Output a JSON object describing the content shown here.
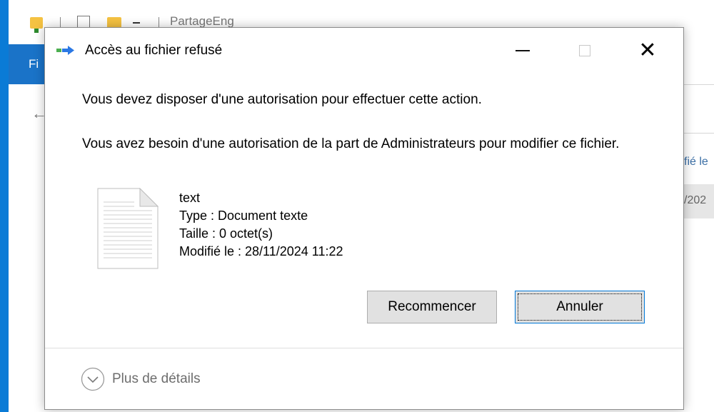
{
  "background_window": {
    "title": "PartageEng",
    "ribbon_tab": "Fi",
    "back_arrow": "←",
    "column_label": "fié le",
    "cell_value": "/202",
    "accent_color": "#0a7bd6"
  },
  "dialog": {
    "title": "Accès au fichier refusé",
    "title_icon": "file-move-icon",
    "controls": {
      "minimize": "minimize-icon",
      "maximize": "maximize-icon",
      "close_glyph": "✕"
    },
    "message_primary": "Vous devez disposer d'une autorisation pour effectuer cette action.",
    "message_secondary": "Vous avez besoin d'une autorisation de la part de Administrateurs pour modifier ce fichier.",
    "file": {
      "icon": "text-document-icon",
      "name": "text",
      "type": "Type : Document texte",
      "size": "Taille : 0 octet(s)",
      "modified": "Modifié le : 28/11/2024 11:22"
    },
    "buttons": {
      "retry": "Recommencer",
      "cancel": "Annuler"
    },
    "details": {
      "icon": "chevron-down-circle-icon",
      "label": "Plus de détails"
    }
  }
}
